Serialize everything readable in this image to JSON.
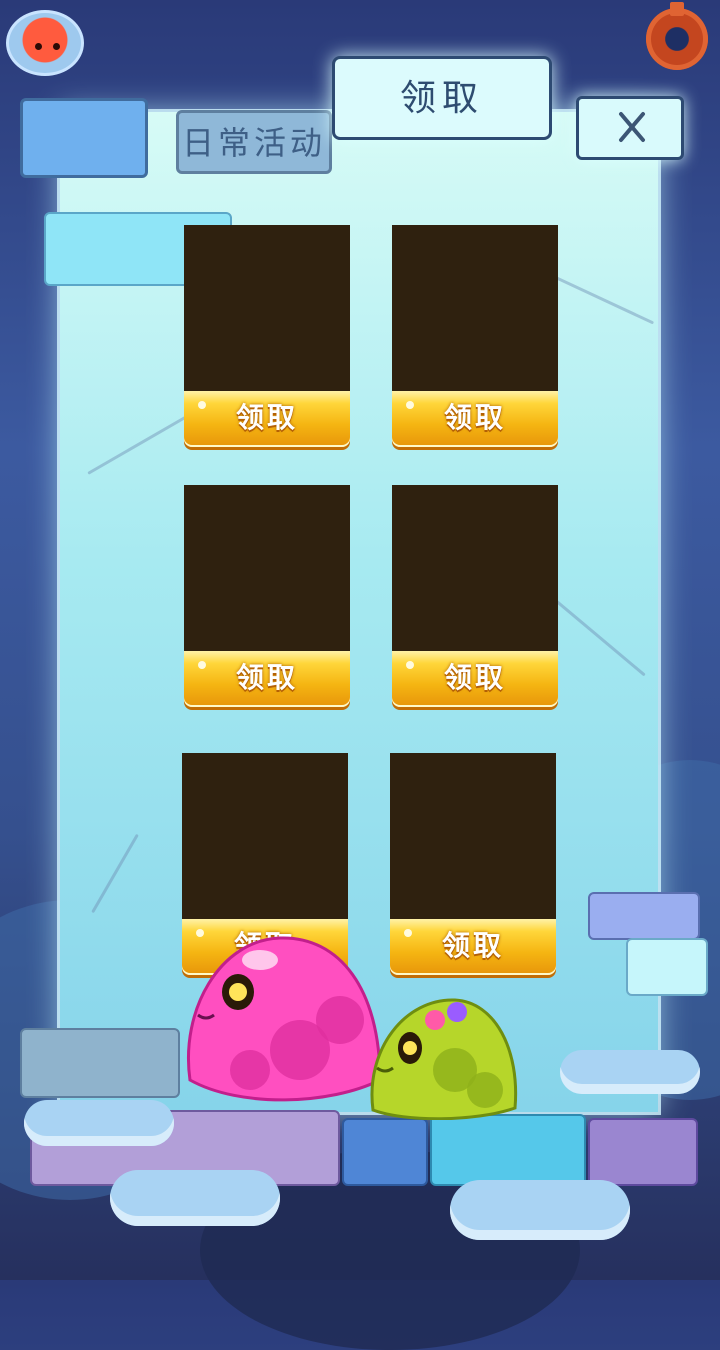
{
  "tabs": {
    "daily": "日常活动",
    "claim": "领取"
  },
  "close_icon": "✕",
  "claim_slots": [
    {
      "button_label": "领取"
    },
    {
      "button_label": "领取"
    },
    {
      "button_label": "领取"
    },
    {
      "button_label": "领取"
    },
    {
      "button_label": "领取"
    },
    {
      "button_label": "领取"
    }
  ],
  "icons": {
    "avatar": "slime-avatar-icon",
    "settings": "gear-icon",
    "close": "close-icon"
  },
  "colors": {
    "gold_button": "#f5b512",
    "slot_box": "#2f210f",
    "panel": "#a7eaf1",
    "pink_slime": "#ff4fc0",
    "green_slime": "#b6d62a"
  }
}
